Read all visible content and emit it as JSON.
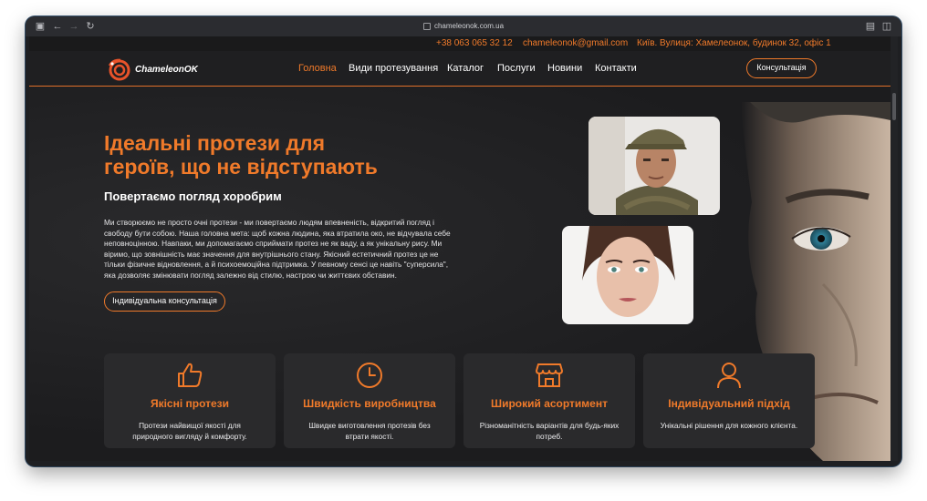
{
  "browser": {
    "url": "chameleonok.com.ua"
  },
  "topbar": {
    "phone": "+38 063 065 32 12",
    "email": "chameleonok@gmail.com",
    "address": "Київ. Вулиця: Хамелеонок, будинок 32, офіс 1"
  },
  "nav": {
    "logo_text": "ChameleonOK",
    "items": [
      "Головна",
      "Види протезування",
      "Каталог",
      "Послуги",
      "Новини",
      "Контакти"
    ],
    "cta": "Консультація"
  },
  "hero": {
    "title": "Ідеальні протези для героїв, що не відступають",
    "subtitle": "Повертаємо погляд хоробрим",
    "paragraph": "Ми створюємо не просто очні протези - ми повертаємо людям впевненість, відкритий погляд і свободу бути собою. Наша головна мета: щоб кожна людина, яка втратила око, не відчувала себе неповноцінною. Навпаки, ми допомагаємо сприймати протез не як ваду, а як унікальну рису. Ми віримо, що зовнішність має значення для внутрішнього стану. Якісний естетичний протез це не тільки фізичне відновлення, а й психоемоційна підтримка. У певному сенсі це навіть \"суперсила\", яка дозволяє змінювати погляд залежно від стилю, настрою чи життєвих обставин.",
    "cta": "Індивідуальна консультація"
  },
  "features": [
    {
      "icon": "thumbs-up-icon",
      "title": "Якісні протези",
      "text": "Протези найвищої якості для природного вигляду й комфорту."
    },
    {
      "icon": "clock-icon",
      "title": "Швидкість виробництва",
      "text": "Швидке виготовлення протезів без втрати якості."
    },
    {
      "icon": "store-icon",
      "title": "Широкий асортимент",
      "text": "Різноманітність варіантів для будь-яких потреб."
    },
    {
      "icon": "user-icon",
      "title": "Індивідуальний підхід",
      "text": "Унікальні рішення для кожного клієнта."
    }
  ],
  "colors": {
    "accent": "#f07a2a",
    "background": "#1c1c1e",
    "card": "#2a2a2c"
  }
}
